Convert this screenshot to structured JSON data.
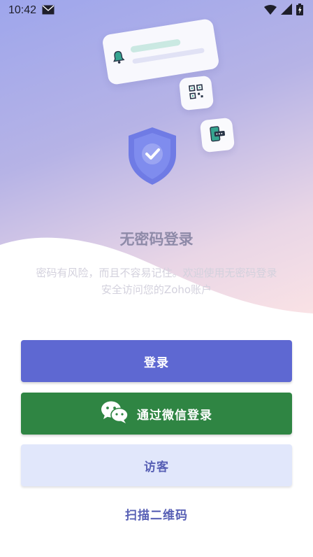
{
  "status_bar": {
    "time": "10:42",
    "icons": [
      "mail-icon",
      "wifi-icon",
      "signal-icon",
      "battery-icon"
    ]
  },
  "hero": {
    "title": "无密码登录",
    "description_line1": "密码有风险，而且不容易记住。欢迎使用无密码登录",
    "description_line2": "安全访问您的Zoho账户",
    "illustration": {
      "icons": [
        "bell-icon",
        "qr-code-icon",
        "otp-device-icon",
        "shield-check-icon"
      ]
    }
  },
  "actions": {
    "login_label": "登录",
    "wechat_label": "通过微信登录",
    "guest_label": "访客",
    "scan_qr_label": "扫描二维码"
  },
  "colors": {
    "primary": "#5e68d2",
    "wechat": "#2f8543",
    "guest_bg": "#e1e7fb",
    "accent_text": "#5860b5"
  }
}
